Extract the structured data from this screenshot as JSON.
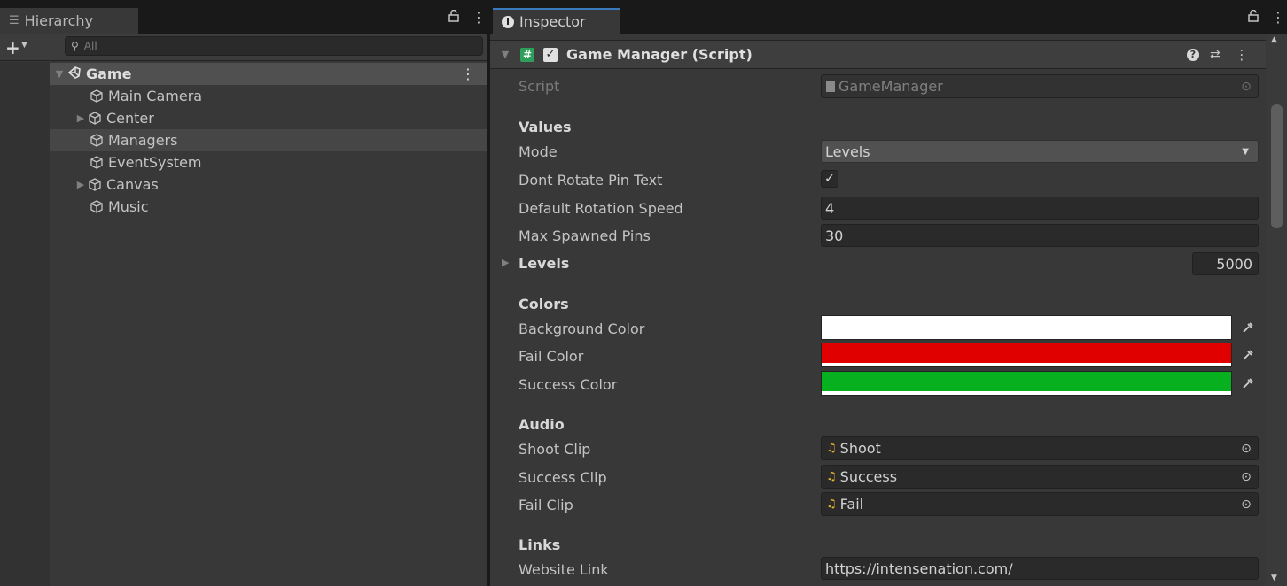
{
  "hierarchy": {
    "tab_label": "Hierarchy",
    "search_placeholder": "All",
    "items": [
      {
        "label": "Game",
        "type": "scene",
        "expanded": true
      },
      {
        "label": "Main Camera",
        "type": "object"
      },
      {
        "label": "Center",
        "type": "object",
        "collapsed": true
      },
      {
        "label": "Managers",
        "type": "object",
        "selected": true
      },
      {
        "label": "EventSystem",
        "type": "object"
      },
      {
        "label": "Canvas",
        "type": "object",
        "collapsed": true
      },
      {
        "label": "Music",
        "type": "object"
      }
    ]
  },
  "inspector": {
    "tab_label": "Inspector",
    "component": {
      "title": "Game Manager (Script)",
      "enabled": true,
      "script_label": "Script",
      "script_value": "GameManager"
    },
    "sections": {
      "values": "Values",
      "colors": "Colors",
      "audio": "Audio",
      "links": "Links"
    },
    "fields": {
      "mode_label": "Mode",
      "mode_value": "Levels",
      "dont_rotate_label": "Dont Rotate Pin Text",
      "dont_rotate_checked": true,
      "rotation_speed_label": "Default Rotation Speed",
      "rotation_speed_value": "4",
      "max_pins_label": "Max Spawned Pins",
      "max_pins_value": "30",
      "levels_label": "Levels",
      "levels_value": "5000",
      "background_color_label": "Background Color",
      "background_color": "#ffffff",
      "fail_color_label": "Fail Color",
      "fail_color": "#e00000",
      "success_color_label": "Success Color",
      "success_color": "#06b01e",
      "shoot_clip_label": "Shoot Clip",
      "shoot_clip_value": "Shoot",
      "success_clip_label": "Success Clip",
      "success_clip_value": "Success",
      "fail_clip_label": "Fail Clip",
      "fail_clip_value": "Fail",
      "website_link_label": "Website Link",
      "website_link_value": "https://intensenation.com/"
    }
  },
  "colors": {
    "accent_tab": "#3a79bb",
    "script_icon": "#2e9e5b",
    "audio_icon": "#e8b62e"
  }
}
